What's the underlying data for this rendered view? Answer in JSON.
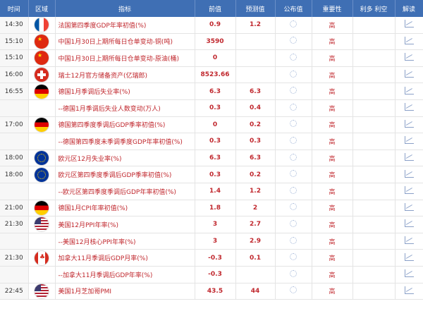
{
  "headers": [
    "时间",
    "区域",
    "指标",
    "前值",
    "预测值",
    "公布值",
    "重要性",
    "利多 利空",
    "解读"
  ],
  "rows": [
    {
      "time": "14:30",
      "flag": "fr",
      "indicator": "法国第四季度GDP年率初值(%)",
      "prev": "0.9",
      "fcst": "1.2",
      "imp": "高"
    },
    {
      "time": "15:10",
      "flag": "cn",
      "indicator": "中国1月30日上期所每日仓单变动-铜(吨)",
      "prev": "3590",
      "fcst": "",
      "imp": "高"
    },
    {
      "time": "15:10",
      "flag": "cn",
      "indicator": "中国1月30日上期所每日仓单变动-原油(桶)",
      "prev": "0",
      "fcst": "",
      "imp": "高"
    },
    {
      "time": "16:00",
      "flag": "ch",
      "indicator": "瑞士12月官方储备资产(亿瑞郎)",
      "prev": "8523.66",
      "fcst": "",
      "imp": "高"
    },
    {
      "time": "16:55",
      "flag": "de",
      "indicator": "德国1月季调后失业率(%)",
      "prev": "6.3",
      "fcst": "6.3",
      "imp": "高"
    },
    {
      "time": "",
      "flag": "",
      "indicator": "--德国1月季调后失业人数变动(万人)",
      "prev": "0.3",
      "fcst": "0.4",
      "imp": "高"
    },
    {
      "time": "17:00",
      "flag": "de",
      "indicator": "德国第四季度季调后GDP季率初值(%)",
      "prev": "0",
      "fcst": "0.2",
      "imp": "高"
    },
    {
      "time": "",
      "flag": "",
      "indicator": "--德国第四季度未季调季度GDP年率初值(%)",
      "prev": "0.3",
      "fcst": "0.3",
      "imp": "高"
    },
    {
      "time": "18:00",
      "flag": "eu",
      "indicator": "欧元区12月失业率(%)",
      "prev": "6.3",
      "fcst": "6.3",
      "imp": "高"
    },
    {
      "time": "18:00",
      "flag": "eu",
      "indicator": "欧元区第四季度季调后GDP季率初值(%)",
      "prev": "0.3",
      "fcst": "0.2",
      "imp": "高"
    },
    {
      "time": "",
      "flag": "",
      "indicator": "--欧元区第四季度季调后GDP年率初值(%)",
      "prev": "1.4",
      "fcst": "1.2",
      "imp": "高"
    },
    {
      "time": "21:00",
      "flag": "de",
      "indicator": "德国1月CPI年率初值(%)",
      "prev": "1.8",
      "fcst": "2",
      "imp": "高"
    },
    {
      "time": "21:30",
      "flag": "us",
      "indicator": "美国12月PPI年率(%)",
      "prev": "3",
      "fcst": "2.7",
      "imp": "高"
    },
    {
      "time": "",
      "flag": "",
      "indicator": "--美国12月核心PPI年率(%)",
      "prev": "3",
      "fcst": "2.9",
      "imp": "高"
    },
    {
      "time": "21:30",
      "flag": "ca",
      "indicator": "加拿大11月季调后GDP月率(%)",
      "prev": "-0.3",
      "fcst": "0.1",
      "imp": "高"
    },
    {
      "time": "",
      "flag": "",
      "indicator": "--加拿大11月季调后GDP年率(%)",
      "prev": "-0.3",
      "fcst": "",
      "imp": "高"
    },
    {
      "time": "22:45",
      "flag": "us",
      "indicator": "美国1月芝加哥PMI",
      "prev": "43.5",
      "fcst": "44",
      "imp": "高"
    }
  ]
}
